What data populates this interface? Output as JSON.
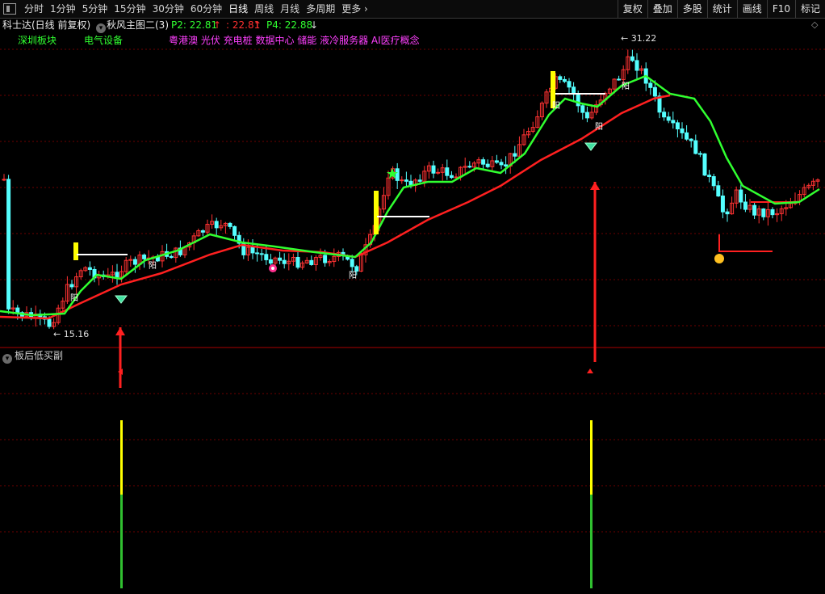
{
  "toolbar": {
    "periods": [
      "分时",
      "1分钟",
      "5分钟",
      "15分钟",
      "30分钟",
      "60分钟",
      "日线",
      "周线",
      "月线",
      "多周期",
      "更多"
    ],
    "active_period": "日线",
    "right_buttons": [
      "复权",
      "叠加",
      "多股",
      "统计",
      "画线",
      "F10",
      "标记"
    ]
  },
  "header": {
    "title": "科士达(日线 前复权)",
    "indicator": "秋风主图二(3)",
    "p2": "P2: 22.81",
    "p3": ": 22.81",
    "p4": "P4: 22.88"
  },
  "tags": {
    "board": "深圳板块",
    "industry": "电气设备",
    "concepts": "粤港澳 光伏 充电桩 数据中心 储能 液冷服务器 AI医疗概念"
  },
  "annotations": {
    "high": "31.22",
    "low": "15.16",
    "yang": "阳"
  },
  "sub_panel": {
    "title": "板后低买副"
  },
  "colors": {
    "up": "#ff3232",
    "down": "#54ffff",
    "ma_red": "#ff2020",
    "ma_green": "#30ff30",
    "grid": "#6e0000",
    "signal_yellow": "#ffff00"
  }
}
